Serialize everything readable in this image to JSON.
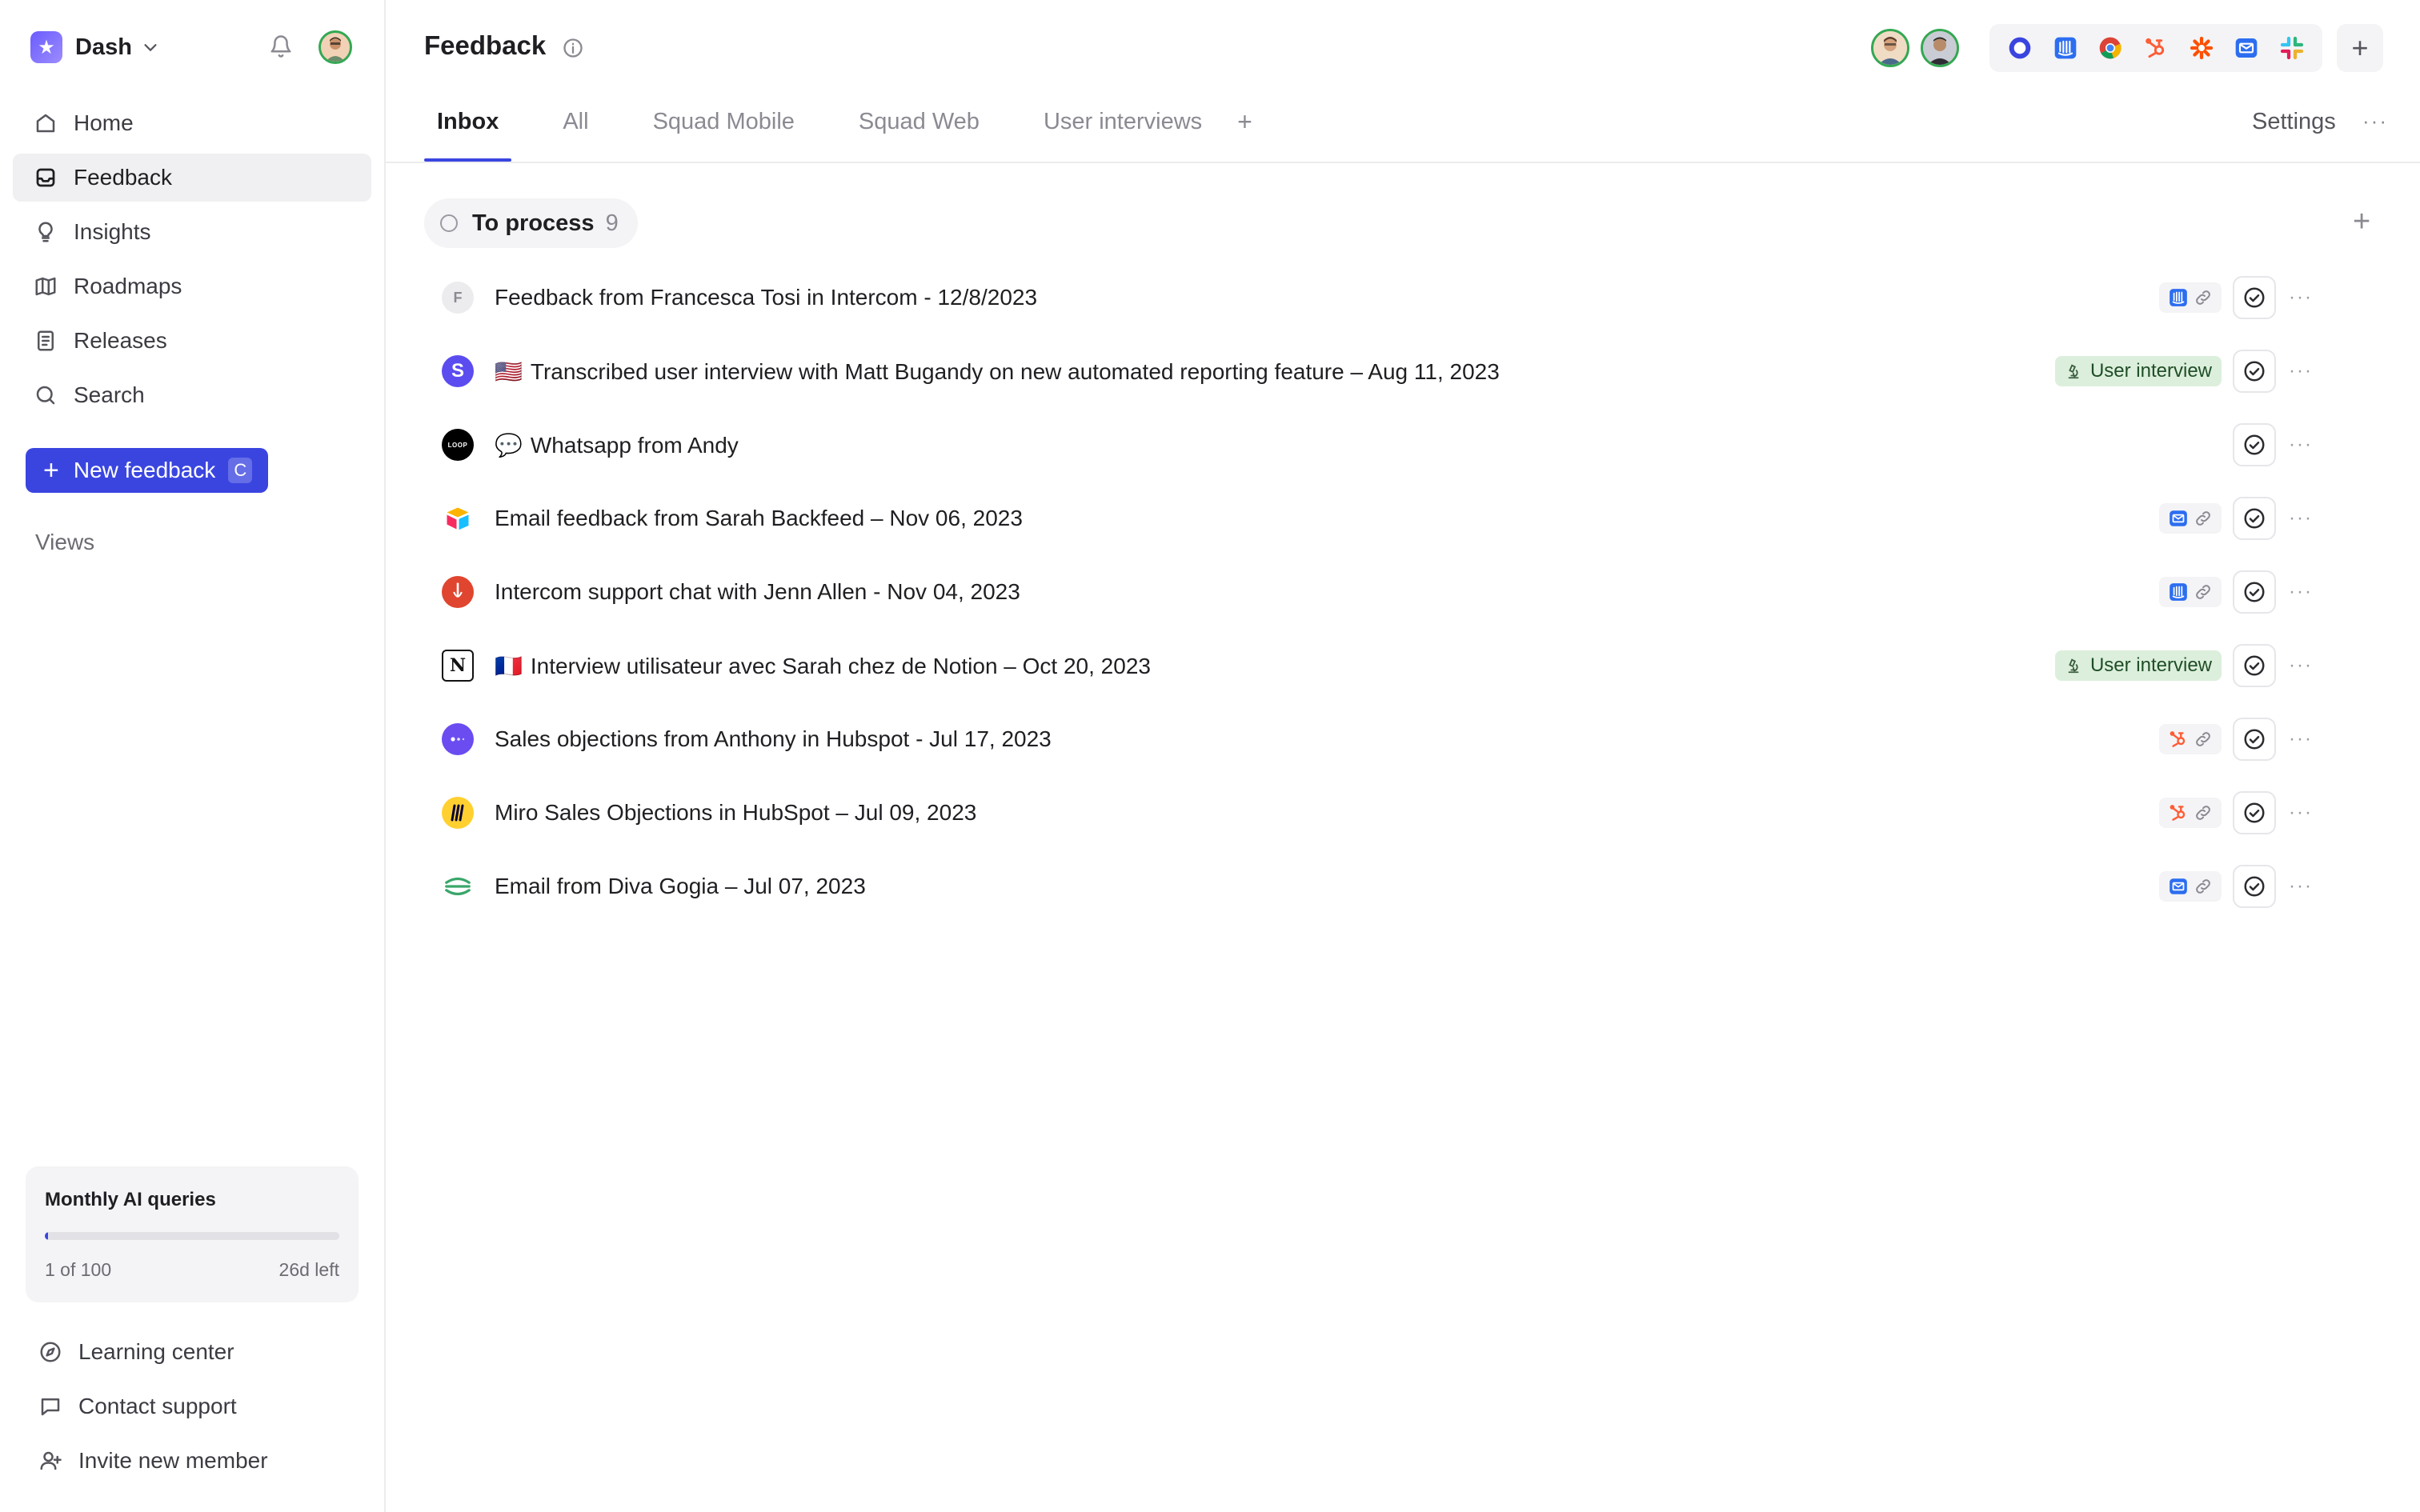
{
  "workspace": {
    "name": "Dash"
  },
  "sidebar": {
    "nav": [
      {
        "label": "Home",
        "icon": "home-icon"
      },
      {
        "label": "Feedback",
        "icon": "inbox-icon",
        "active": true
      },
      {
        "label": "Insights",
        "icon": "lightbulb-icon"
      },
      {
        "label": "Roadmaps",
        "icon": "map-icon"
      },
      {
        "label": "Releases",
        "icon": "document-icon"
      },
      {
        "label": "Search",
        "icon": "search-icon"
      }
    ],
    "new_feedback": {
      "label": "New feedback",
      "shortcut": "C"
    },
    "views_label": "Views",
    "ai_queries": {
      "title": "Monthly AI queries",
      "used_text": "1 of 100",
      "remaining_text": "26d left",
      "progress": 0.01
    },
    "bottom_links": [
      {
        "label": "Learning center",
        "icon": "compass-icon"
      },
      {
        "label": "Contact support",
        "icon": "chat-bubble-icon"
      },
      {
        "label": "Invite new member",
        "icon": "user-plus-icon"
      }
    ]
  },
  "header": {
    "title": "Feedback",
    "integrations": [
      "circle-app-icon",
      "intercom-icon",
      "chrome-icon",
      "hubspot-icon",
      "zapier-icon",
      "email-icon",
      "slack-icon"
    ]
  },
  "tabs": {
    "items": [
      {
        "label": "Inbox",
        "active": true
      },
      {
        "label": "All"
      },
      {
        "label": "Squad Mobile"
      },
      {
        "label": "Squad Web"
      },
      {
        "label": "User interviews"
      }
    ],
    "add": "+",
    "settings": "Settings"
  },
  "group": {
    "label": "To process",
    "count": "9"
  },
  "rows": [
    {
      "title": "Feedback from Francesca Tosi in Intercom - 12/8/2023",
      "avatar": "F",
      "avatar_kind": "letter",
      "flag": "",
      "source": "intercom",
      "tag": ""
    },
    {
      "title": "Transcribed user interview with Matt Bugandy on new automated reporting feature – Aug 11, 2023",
      "avatar": "S",
      "avatar_kind": "s-logo",
      "flag": "🇺🇸",
      "source": "",
      "tag": "User interview"
    },
    {
      "title": "Whatsapp from Andy",
      "avatar": "LOOP",
      "avatar_kind": "loop",
      "flag": "💬",
      "source": "",
      "tag": ""
    },
    {
      "title": "Email feedback from Sarah Backfeed – Nov 06, 2023",
      "avatar": "",
      "avatar_kind": "airtable",
      "flag": "",
      "source": "email",
      "tag": ""
    },
    {
      "title": "Intercom support chat with Jenn Allen - Nov 04, 2023",
      "avatar": "",
      "avatar_kind": "red-pin",
      "flag": "",
      "source": "intercom",
      "tag": ""
    },
    {
      "title": "Interview utilisateur avec Sarah chez de Notion –  Oct 20, 2023",
      "avatar": "N",
      "avatar_kind": "notion",
      "flag": "🇫🇷",
      "source": "",
      "tag": "User interview"
    },
    {
      "title": "Sales objections from Anthony in Hubspot - Jul 17, 2023",
      "avatar": "",
      "avatar_kind": "purple-dots",
      "flag": "",
      "source": "hubspot",
      "tag": ""
    },
    {
      "title": "Miro Sales Objections in HubSpot – Jul 09, 2023",
      "avatar": "",
      "avatar_kind": "miro",
      "flag": "",
      "source": "hubspot",
      "tag": ""
    },
    {
      "title": "Email from Diva Gogia – Jul 07, 2023",
      "avatar": "",
      "avatar_kind": "green-lines",
      "flag": "",
      "source": "email",
      "tag": ""
    }
  ],
  "colors": {
    "accent": "#3a45e0",
    "tag_bg": "#dcefdc",
    "online": "#34a853"
  }
}
